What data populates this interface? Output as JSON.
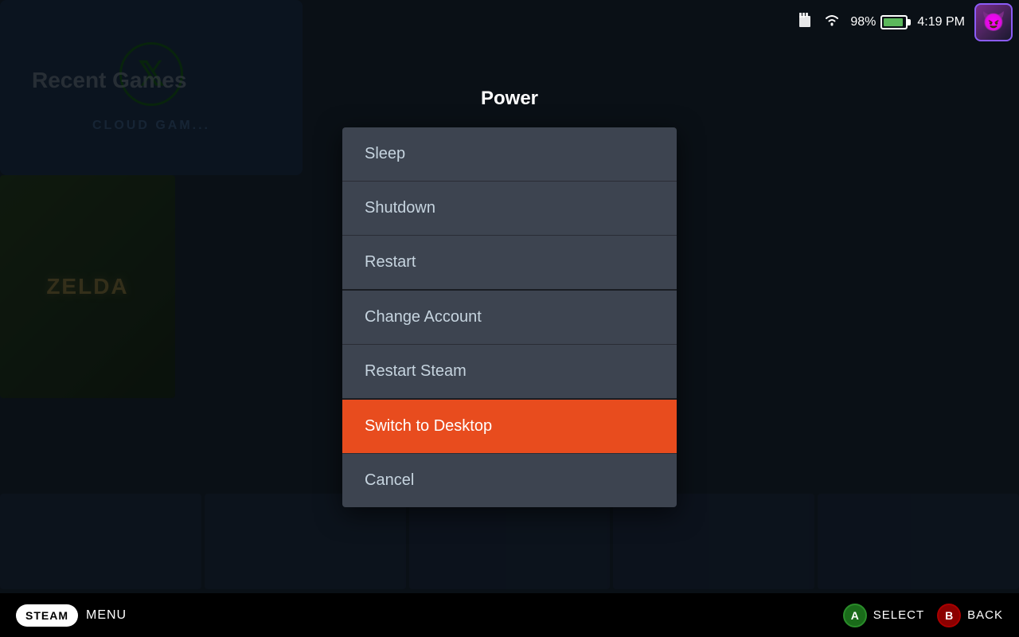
{
  "background": {
    "title": "Recent Games",
    "cloud_label": "CLOUD GAM..."
  },
  "status_bar": {
    "battery_percent": "98%",
    "time": "4:19 PM"
  },
  "power_dialog": {
    "title": "Power",
    "menu_items": [
      {
        "id": "sleep",
        "label": "Sleep",
        "active": false,
        "separator": false
      },
      {
        "id": "shutdown",
        "label": "Shutdown",
        "active": false,
        "separator": false
      },
      {
        "id": "restart",
        "label": "Restart",
        "active": false,
        "separator": true
      },
      {
        "id": "change-account",
        "label": "Change Account",
        "active": false,
        "separator": false
      },
      {
        "id": "restart-steam",
        "label": "Restart Steam",
        "active": false,
        "separator": true
      },
      {
        "id": "switch-desktop",
        "label": "Switch to Desktop",
        "active": true,
        "separator": false
      },
      {
        "id": "cancel",
        "label": "Cancel",
        "active": false,
        "separator": false
      }
    ]
  },
  "bottom_bar": {
    "steam_label": "STEAM",
    "menu_label": "MENU",
    "select_label": "SELECT",
    "back_label": "BACK",
    "a_label": "A",
    "b_label": "B"
  }
}
